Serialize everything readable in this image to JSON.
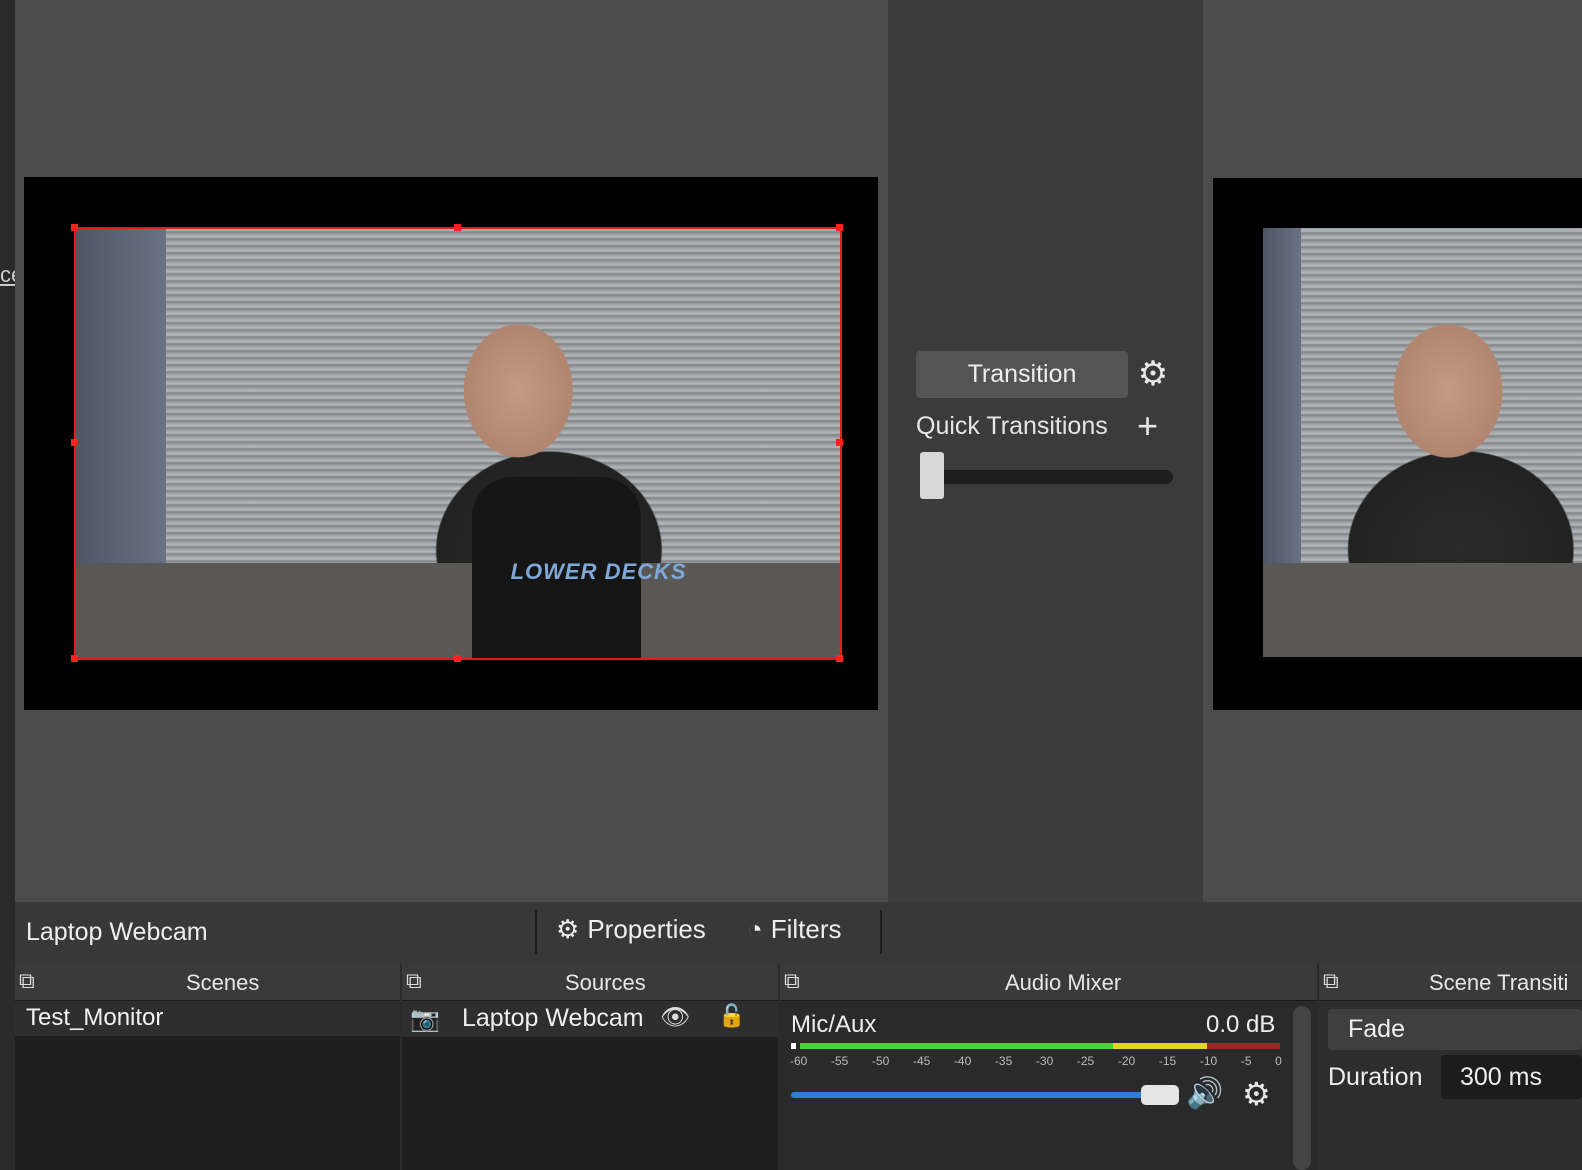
{
  "left_fragment": "ce",
  "transition": {
    "button_label": "Transition",
    "quick_label": "Quick Transitions"
  },
  "preview": {
    "shirt_text": "LOWER DECKS"
  },
  "source_toolbar": {
    "selected_source": "Laptop Webcam",
    "properties_label": "Properties",
    "filters_label": "Filters"
  },
  "docks": {
    "scenes": {
      "title": "Scenes",
      "items": [
        "Test_Monitor"
      ]
    },
    "sources": {
      "title": "Sources",
      "items": [
        {
          "label": "Laptop Webcam",
          "visible": true,
          "locked": false
        }
      ]
    },
    "audio_mixer": {
      "title": "Audio Mixer",
      "channel": "Mic/Aux",
      "level": "0.0 dB",
      "ticks": [
        "-60",
        "-55",
        "-50",
        "-45",
        "-40",
        "-35",
        "-30",
        "-25",
        "-20",
        "-15",
        "-10",
        "-5",
        "0"
      ],
      "volume_fraction": 0.97
    },
    "scene_transitions": {
      "title": "Scene Transiti",
      "selected": "Fade",
      "duration_label": "Duration",
      "duration_value": "300 ms"
    }
  },
  "colors": {
    "selection": "#e31b1b",
    "volume": "#2f7cd9",
    "meter_green": "#39d739",
    "meter_yellow": "#e2d51e",
    "meter_red": "#a62424"
  },
  "icons": [
    "gear-icon",
    "plus-icon",
    "filters-icon",
    "dock-float-icon",
    "camera-icon",
    "eye-icon",
    "lock-icon",
    "speaker-icon"
  ]
}
